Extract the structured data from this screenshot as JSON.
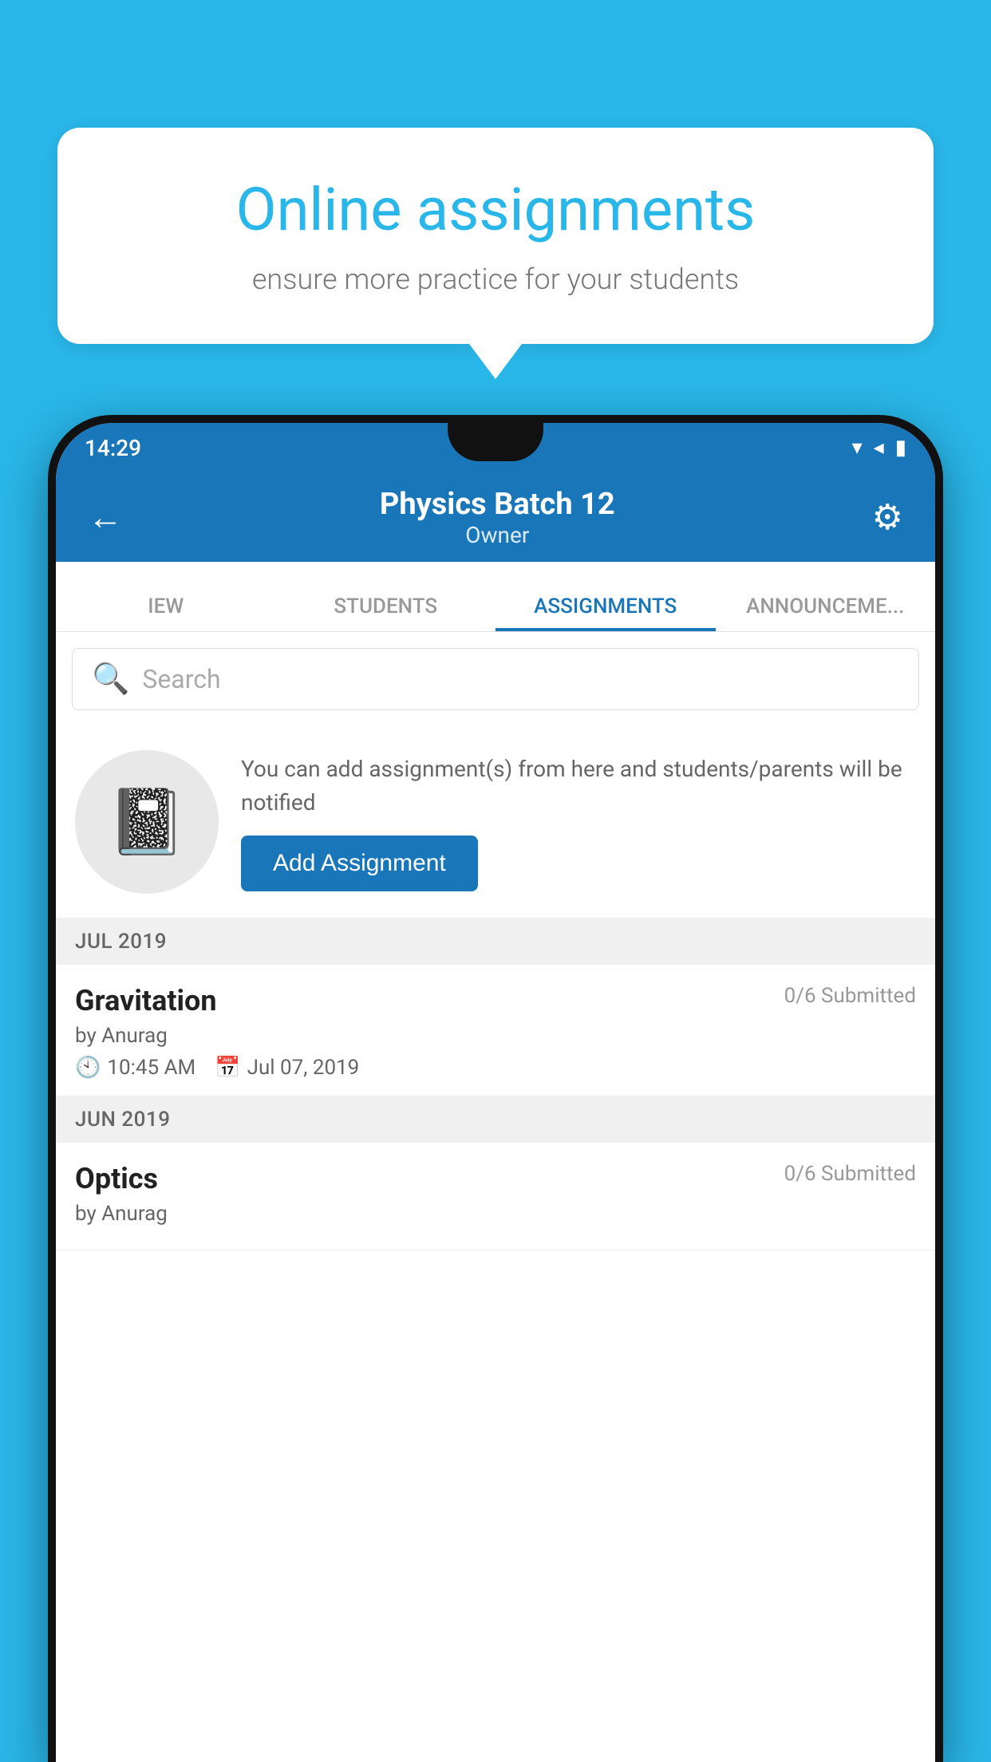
{
  "background": "#29B6E8",
  "bubble": {
    "title": "Online assignments",
    "subtitle": "ensure more practice for your students"
  },
  "phone": {
    "status_bar": {
      "time": "14:29",
      "icons": [
        "▾",
        "◂",
        "▮"
      ]
    },
    "app_bar": {
      "title": "Physics Batch 12",
      "subtitle": "Owner",
      "back_label": "←",
      "settings_label": "⚙"
    },
    "tabs": [
      {
        "label": "IEW",
        "active": false
      },
      {
        "label": "STUDENTS",
        "active": false
      },
      {
        "label": "ASSIGNMENTS",
        "active": true
      },
      {
        "label": "ANNOUNCEMENTS",
        "active": false
      }
    ],
    "search": {
      "placeholder": "Search"
    },
    "empty_state": {
      "description": "You can add assignment(s) from here and students/parents will be notified",
      "button_label": "Add Assignment"
    },
    "sections": [
      {
        "header": "JUL 2019",
        "assignments": [
          {
            "name": "Gravitation",
            "submitted": "0/6 Submitted",
            "by": "by Anurag",
            "time": "10:45 AM",
            "date": "Jul 07, 2019"
          }
        ]
      },
      {
        "header": "JUN 2019",
        "assignments": [
          {
            "name": "Optics",
            "submitted": "0/6 Submitted",
            "by": "by Anurag",
            "time": "",
            "date": ""
          }
        ]
      }
    ]
  }
}
